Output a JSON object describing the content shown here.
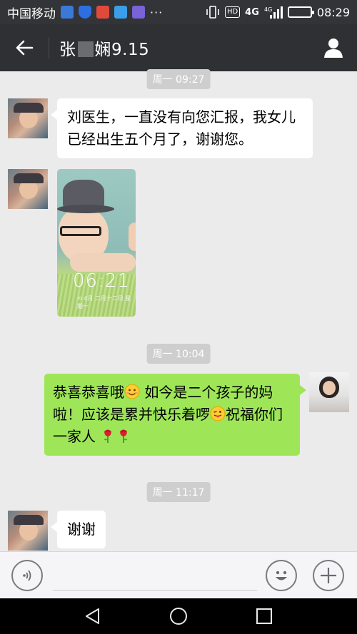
{
  "status_bar": {
    "carrier": "中国移动",
    "hd_label": "HD",
    "network_label": "4G",
    "network_label_small": "4G",
    "more": "···",
    "time": "08:29",
    "battery_level": 0.75
  },
  "header": {
    "title_prefix": "张",
    "title_suffix": "娴9.15",
    "back_icon": "arrow-left-icon",
    "profile_icon": "person-icon"
  },
  "messages": {
    "ts1": "周一 09:27",
    "msg1": "刘医生，一直没有向您汇报，我女儿已经出生五个月了，谢谢您。",
    "photo": {
      "clock": "06:21",
      "date": "⟲ 4月  二月十二日 星期一"
    },
    "ts2": "周一 10:04",
    "msg2": {
      "part1": "恭喜恭喜哦",
      "part2": " 如今是二个孩子的妈啦！应该是累并快乐着啰",
      "part3": "祝福你们一家人",
      "emoji1": "smiling-face-emoji",
      "emoji2": "winking-tongue-emoji",
      "emoji3": "rose-emoji"
    },
    "ts3": "周一 11:17",
    "msg3": "谢谢"
  },
  "input_bar": {
    "voice_icon": "voice-icon",
    "input_value": "",
    "emoji_icon": "emoji-icon",
    "plus_icon": "plus-icon"
  },
  "nav_bar": {
    "back_icon": "nav-back-icon",
    "home_icon": "nav-home-icon",
    "recents_icon": "nav-recents-icon"
  },
  "colors": {
    "header_bg": "#2f3034",
    "chat_bg": "#ebebeb",
    "bubble_out": "#9ee658",
    "bubble_in": "#ffffff",
    "timestamp_bg": "#cecece"
  }
}
